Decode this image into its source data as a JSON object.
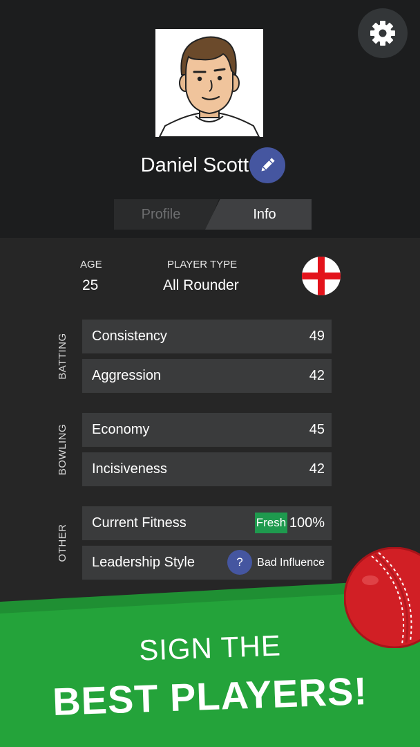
{
  "header": {
    "player_name": "Daniel Scott",
    "settings_icon": "gear-icon",
    "edit_icon": "pencil-icon"
  },
  "tabs": [
    {
      "label": "Profile",
      "active": false
    },
    {
      "label": "Info",
      "active": true
    }
  ],
  "info": {
    "age_label": "AGE",
    "age_value": "25",
    "player_type_label": "PLAYER TYPE",
    "player_type_value": "All Rounder",
    "nationality_flag": "england-flag-icon"
  },
  "groups": {
    "batting": {
      "label": "BATTING",
      "rows": [
        {
          "name": "Consistency",
          "value": "49"
        },
        {
          "name": "Aggression",
          "value": "42"
        }
      ]
    },
    "bowling": {
      "label": "BOWLING",
      "rows": [
        {
          "name": "Economy",
          "value": "45"
        },
        {
          "name": "Incisiveness",
          "value": "42"
        }
      ]
    },
    "other": {
      "label": "OTHER",
      "fitness": {
        "name": "Current Fitness",
        "badge": "Fresh",
        "value": "100%"
      },
      "leadership": {
        "name": "Leadership Style",
        "help": "?",
        "value": "Bad Influence"
      }
    }
  },
  "banner": {
    "line1": "SIGN THE",
    "line2": "BEST PLAYERS!"
  },
  "colors": {
    "header_bg": "#1c1d1e",
    "body_bg": "#262626",
    "row_bg": "#3a3b3c",
    "accent_blue": "#4556a0",
    "fresh_green": "#1e9a4e",
    "banner_green": "#24a33a",
    "ball_red": "#d11f25"
  }
}
